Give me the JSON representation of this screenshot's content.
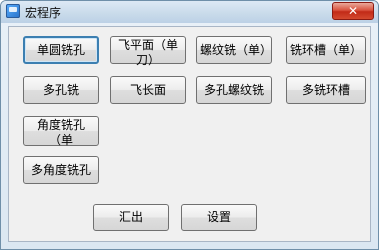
{
  "window": {
    "title": "宏程序",
    "close_glyph": "✕"
  },
  "buttons": {
    "row1": [
      "单圆铣孔",
      "飞平面（单刀）",
      "螺纹铣（单）",
      "铣环槽（单）"
    ],
    "row2": [
      "多孔铣",
      "飞长面",
      "多孔螺纹铣",
      "多铣环槽"
    ],
    "row3": [
      "角度铣孔（单"
    ],
    "row4": [
      "多角度铣孔"
    ],
    "export": "汇出",
    "settings": "设置"
  }
}
